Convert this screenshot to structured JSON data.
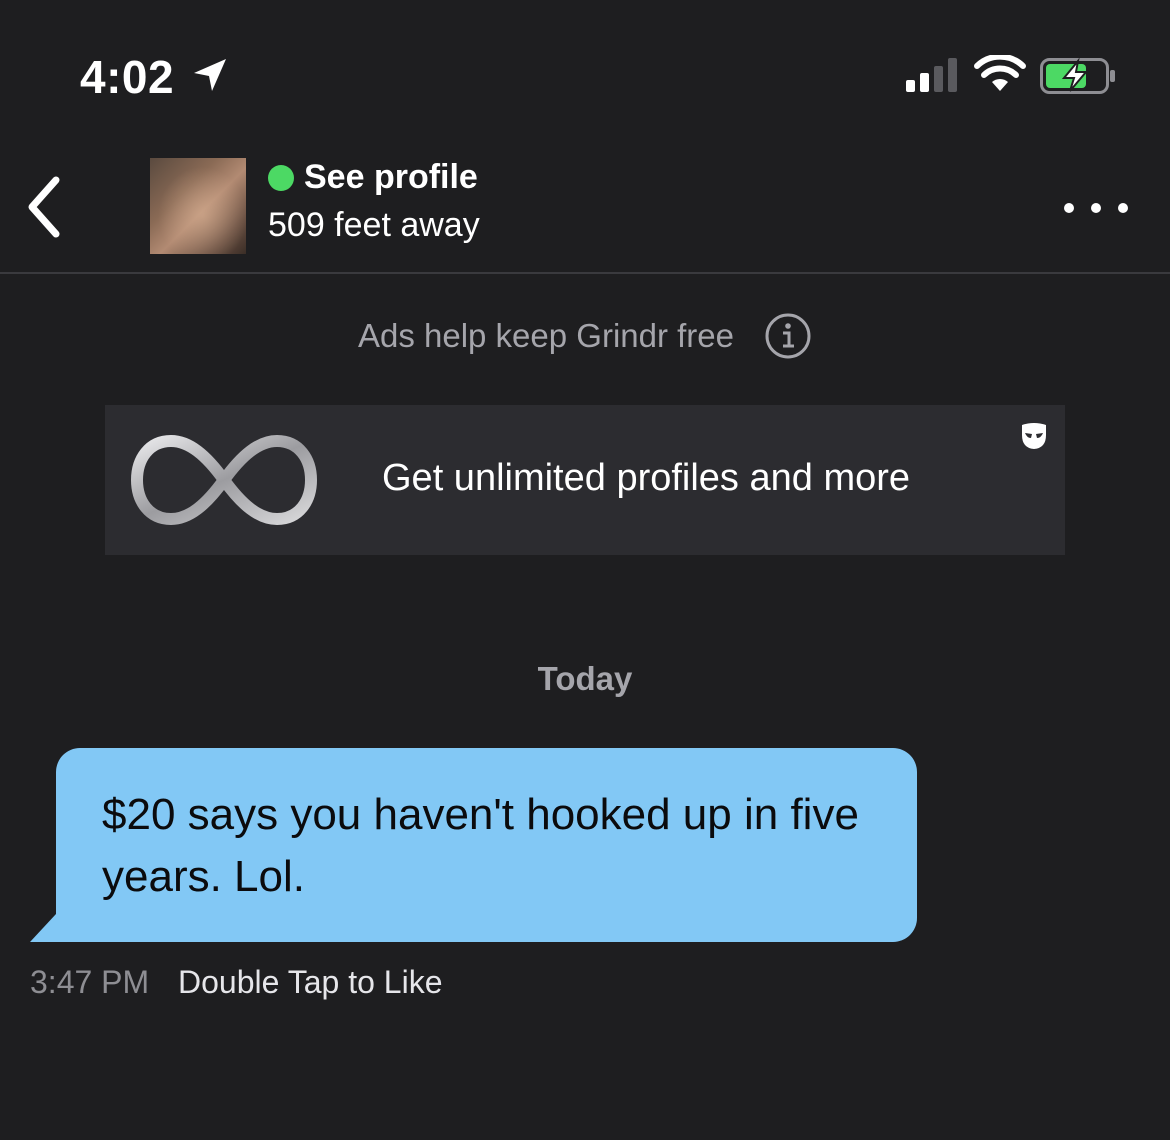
{
  "status_bar": {
    "time": "4:02",
    "icons": [
      "location-arrow-icon",
      "cellular-signal-icon",
      "wifi-icon",
      "battery-charging-icon"
    ],
    "battery_color": "#4cd964"
  },
  "header": {
    "back_icon": "chevron-left-icon",
    "profile_link": "See profile",
    "online_color": "#4cd964",
    "distance": "509 feet away",
    "more_icon": "ellipsis-icon"
  },
  "ad_note": {
    "text": "Ads help keep Grindr free",
    "icon": "info-icon"
  },
  "ad_banner": {
    "icon": "infinity-icon",
    "text": "Get unlimited profiles and more",
    "badge_icon": "grindr-mask-icon"
  },
  "conversation": {
    "date_divider": "Today",
    "messages": [
      {
        "text": "$20 says you haven't hooked up in five years.  Lol.",
        "time": "3:47 PM",
        "like_hint": "Double Tap to Like",
        "bubble_color": "#82c8f5"
      }
    ]
  }
}
